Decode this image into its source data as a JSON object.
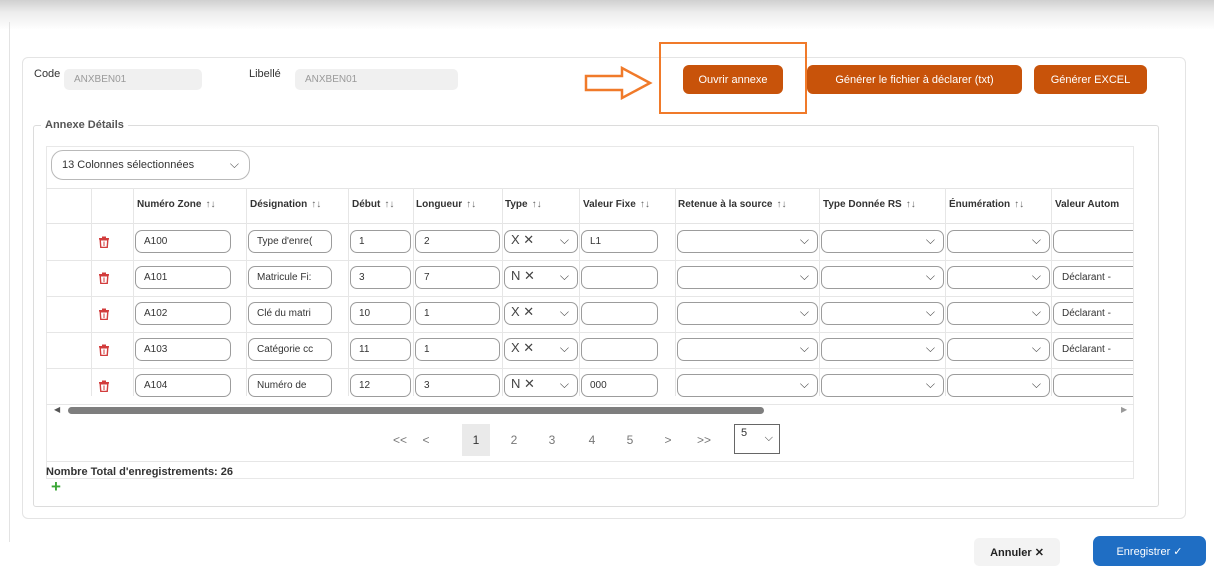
{
  "header": {
    "code_label": "Code",
    "code_value": "ANXBEN01",
    "libelle_label": "Libellé",
    "libelle_value": "ANXBEN01",
    "btn_ouvrir": "Ouvrir annexe",
    "btn_generer_txt": "Générer le fichier à déclarer (txt)",
    "btn_generer_excel": "Générer EXCEL"
  },
  "section": {
    "legend": "Annexe Détails",
    "column_selector": "13 Colonnes sélectionnées"
  },
  "table": {
    "headers": [
      "Numéro Zone",
      "Désignation",
      "Début",
      "Longueur",
      "Type",
      "Valeur Fixe",
      "Retenue à la source",
      "Type Donnée RS",
      "Énumération",
      "Valeur Autom"
    ],
    "sort_icon": "↑↓",
    "rows": [
      {
        "zone": "A100",
        "designation": "Type d'enre(",
        "debut": "1",
        "longueur": "2",
        "type": "X",
        "valeur_fixe": "L1",
        "valeur_auto": ""
      },
      {
        "zone": "A101",
        "designation": "Matricule Fi:",
        "debut": "3",
        "longueur": "7",
        "type": "N",
        "valeur_fixe": "",
        "valeur_auto": "Déclarant -"
      },
      {
        "zone": "A102",
        "designation": "Clé du matri",
        "debut": "10",
        "longueur": "1",
        "type": "X",
        "valeur_fixe": "",
        "valeur_auto": "Déclarant -"
      },
      {
        "zone": "A103",
        "designation": "Catégorie cc",
        "debut": "11",
        "longueur": "1",
        "type": "X",
        "valeur_fixe": "",
        "valeur_auto": "Déclarant -"
      },
      {
        "zone": "A104",
        "designation": "Numéro de",
        "debut": "12",
        "longueur": "3",
        "type": "N",
        "valeur_fixe": "000",
        "valeur_auto": ""
      }
    ]
  },
  "pager": {
    "first": "<<",
    "prev": "<",
    "pages": [
      "1",
      "2",
      "3",
      "4",
      "5"
    ],
    "next": ">",
    "last": ">>",
    "page_size": "5"
  },
  "footer": {
    "total_label": "Nombre Total d'enregistrements: 26",
    "add": "+",
    "cancel": "Annuler ✕",
    "save": "Enregistrer ✓"
  },
  "colors": {
    "accent_orange": "#c8530a",
    "highlight_orange": "#f07a2a",
    "primary_blue": "#1f6ec4",
    "trash_red": "#d23c3c",
    "add_green": "#3aa635"
  }
}
